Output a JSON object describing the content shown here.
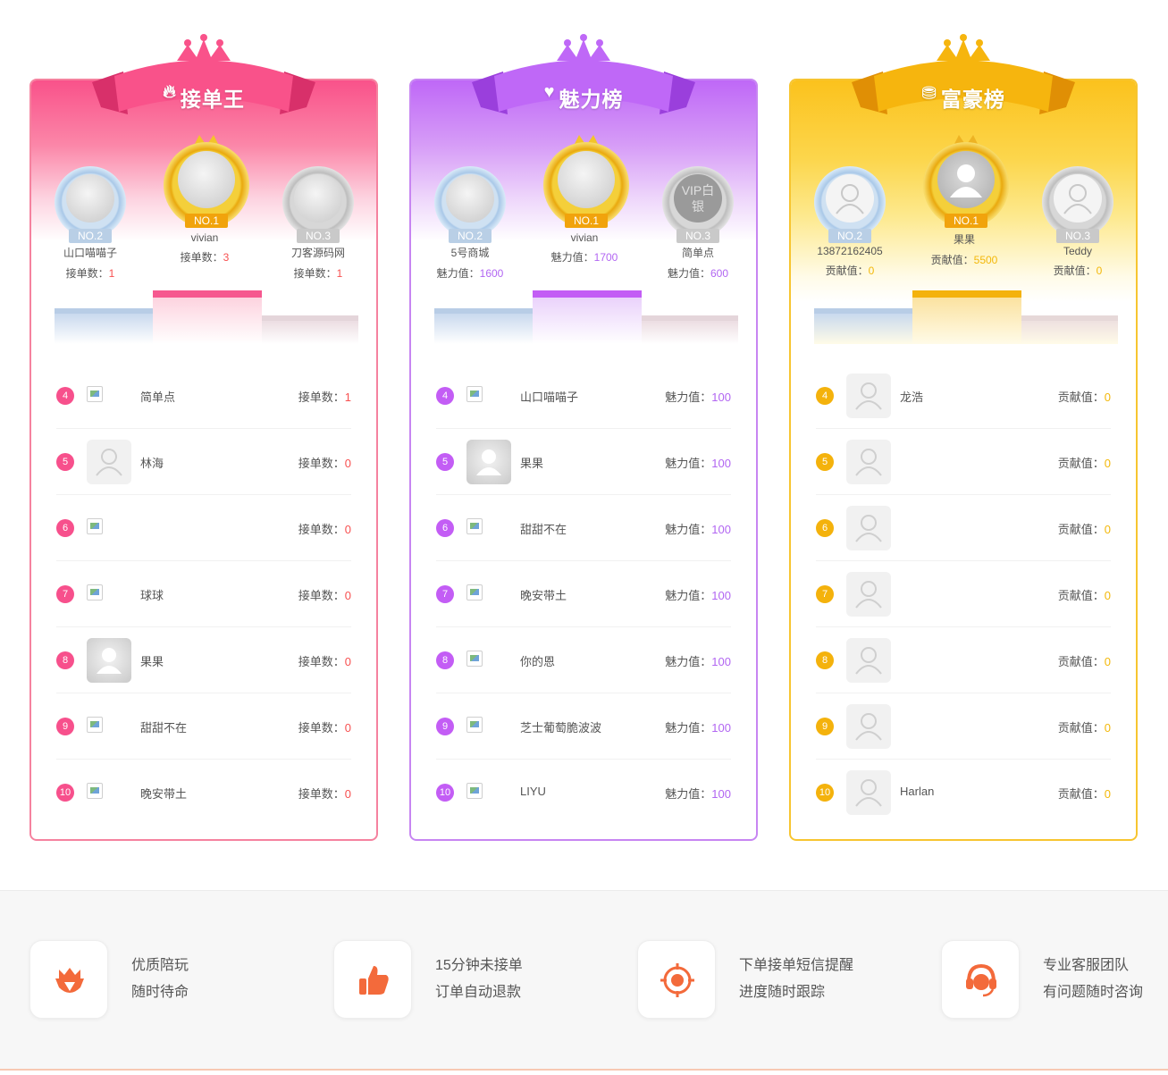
{
  "boards": [
    {
      "key": "pink",
      "title": "接单王",
      "title_icon": "flame-icon",
      "accent": "#f7508c",
      "score_color": "#f75050",
      "podium": [
        {
          "rank": "NO.2",
          "name": "山口喵喵子",
          "score_label": "接单数：",
          "score": "1"
        },
        {
          "rank": "NO.1",
          "name": "vivian",
          "score_label": "接单数：",
          "score": "3"
        },
        {
          "rank": "NO.3",
          "name": "刀客源码网",
          "score_label": "接单数：",
          "score": "1"
        }
      ],
      "rows": [
        {
          "n": "4",
          "name": "简单点",
          "label": "接单数：",
          "value": "1",
          "avatar": "broken"
        },
        {
          "n": "5",
          "name": "林海",
          "label": "接单数：",
          "value": "0",
          "avatar": "default"
        },
        {
          "n": "6",
          "name": "",
          "label": "接单数：",
          "value": "0",
          "avatar": "broken"
        },
        {
          "n": "7",
          "name": "球球",
          "label": "接单数：",
          "value": "0",
          "avatar": "broken"
        },
        {
          "n": "8",
          "name": "果果",
          "label": "接单数：",
          "value": "0",
          "avatar": "grey"
        },
        {
          "n": "9",
          "name": "甜甜不在",
          "label": "接单数：",
          "value": "0",
          "avatar": "broken"
        },
        {
          "n": "10",
          "name": "晚安带土",
          "label": "接单数：",
          "value": "0",
          "avatar": "broken"
        }
      ]
    },
    {
      "key": "purple",
      "title": "魅力榜",
      "title_icon": "heart-icon",
      "accent": "#c35df5",
      "score_color": "#b266f2",
      "podium": [
        {
          "rank": "NO.2",
          "name": "5号商城",
          "score_label": "魅力值：",
          "score": "1600"
        },
        {
          "rank": "NO.1",
          "name": "vivian",
          "score_label": "魅力值：",
          "score": "1700"
        },
        {
          "rank": "NO.3",
          "name": "简单点",
          "score_label": "魅力值：",
          "score": "600",
          "avatar_text": "VIP白银"
        }
      ],
      "rows": [
        {
          "n": "4",
          "name": "山口喵喵子",
          "label": "魅力值：",
          "value": "100",
          "avatar": "broken"
        },
        {
          "n": "5",
          "name": "果果",
          "label": "魅力值：",
          "value": "100",
          "avatar": "grey"
        },
        {
          "n": "6",
          "name": "甜甜不在",
          "label": "魅力值：",
          "value": "100",
          "avatar": "broken"
        },
        {
          "n": "7",
          "name": "晚安带土",
          "label": "魅力值：",
          "value": "100",
          "avatar": "broken"
        },
        {
          "n": "8",
          "name": "你的恩",
          "label": "魅力值：",
          "value": "100",
          "avatar": "broken"
        },
        {
          "n": "9",
          "name": "芝士葡萄脆波波",
          "label": "魅力值：",
          "value": "100",
          "avatar": "broken"
        },
        {
          "n": "10",
          "name": "LIYU",
          "label": "魅力值：",
          "value": "100",
          "avatar": "broken"
        }
      ]
    },
    {
      "key": "gold",
      "title": "富豪榜",
      "title_icon": "coins-icon",
      "accent": "#f4b20c",
      "score_color": "#f3b80a",
      "podium": [
        {
          "rank": "NO.2",
          "name": "13872162405",
          "score_label": "贡献值：",
          "score": "0"
        },
        {
          "rank": "NO.1",
          "name": "果果",
          "score_label": "贡献值：",
          "score": "5500"
        },
        {
          "rank": "NO.3",
          "name": "Teddy",
          "score_label": "贡献值：",
          "score": "0"
        }
      ],
      "rows": [
        {
          "n": "4",
          "name": "龙浩",
          "label": "贡献值：",
          "value": "0",
          "avatar": "default"
        },
        {
          "n": "5",
          "name": "",
          "label": "贡献值：",
          "value": "0",
          "avatar": "default"
        },
        {
          "n": "6",
          "name": "",
          "label": "贡献值：",
          "value": "0",
          "avatar": "default"
        },
        {
          "n": "7",
          "name": "",
          "label": "贡献值：",
          "value": "0",
          "avatar": "default"
        },
        {
          "n": "8",
          "name": "",
          "label": "贡献值：",
          "value": "0",
          "avatar": "default"
        },
        {
          "n": "9",
          "name": "",
          "label": "贡献值：",
          "value": "0",
          "avatar": "default"
        },
        {
          "n": "10",
          "name": "Harlan",
          "label": "贡献值：",
          "value": "0",
          "avatar": "default"
        }
      ]
    }
  ],
  "features": [
    {
      "icon": "shield-crown-icon",
      "line1": "优质陪玩",
      "line2": "随时待命"
    },
    {
      "icon": "thumbs-up-icon",
      "line1": "15分钟未接单",
      "line2": "订单自动退款"
    },
    {
      "icon": "target-icon",
      "line1": "下单接单短信提醒",
      "line2": "进度随时跟踪"
    },
    {
      "icon": "headset-icon",
      "line1": "专业客服团队",
      "line2": "有问题随时咨询"
    }
  ]
}
